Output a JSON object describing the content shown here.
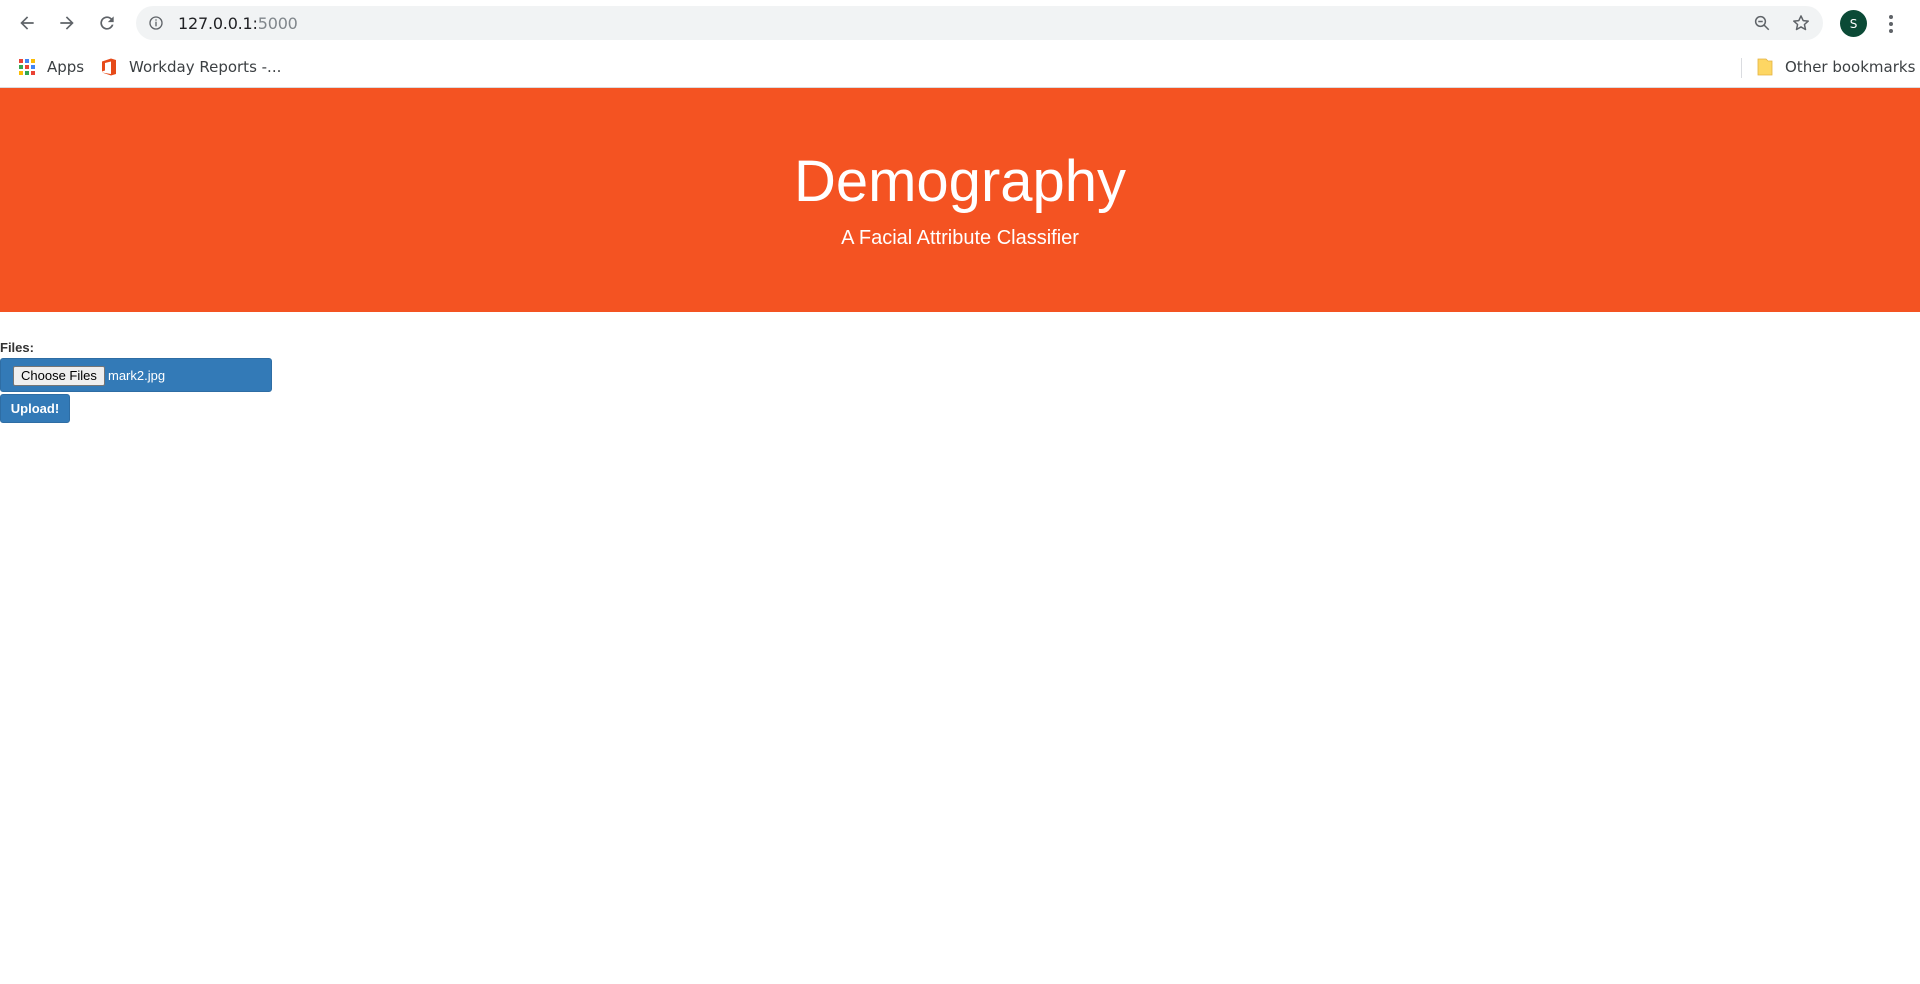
{
  "browser": {
    "url_host": "127.0.0.1:",
    "url_port": "5000",
    "profile_initial": "S",
    "icons": {
      "back": "back-arrow-icon",
      "forward": "forward-arrow-icon",
      "reload": "reload-icon",
      "site_info": "info-icon",
      "zoom": "zoom-out-icon",
      "bookmark_star": "star-icon",
      "menu": "kebab-menu-icon"
    }
  },
  "bookmarks": {
    "apps_label": "Apps",
    "item1_label": "Workday Reports -...",
    "other_label": "Other bookmarks"
  },
  "hero": {
    "title": "Demography",
    "subtitle": "A Facial Attribute Classifier",
    "background": "#f45322"
  },
  "form": {
    "files_label": "Files:",
    "choose_label": "Choose Files",
    "file_name": "mark2.jpg",
    "upload_label": "Upload!",
    "button_color": "#337ab7"
  }
}
